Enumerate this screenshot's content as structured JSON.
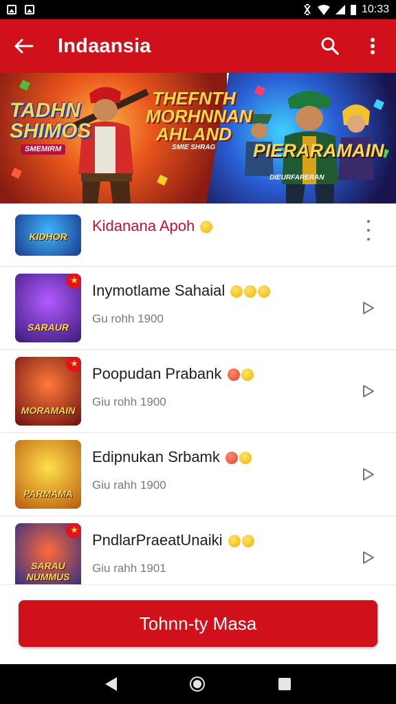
{
  "status_bar": {
    "time": "10:33",
    "icons": [
      "image-notification-icon",
      "photo-notification-icon",
      "vibrate-icon",
      "wifi-icon",
      "signal-icon",
      "battery-icon"
    ]
  },
  "app_bar": {
    "title": "Indaansia",
    "back_icon": "arrow-left-icon",
    "search_icon": "search-icon",
    "menu_icon": "more-vert-icon"
  },
  "banner": {
    "left_text": "TADHN SHIMOS",
    "left_sub": "SMEMIRM",
    "center_text": "THEFNTH MORHNNAN AHLAND",
    "center_sub": "SMIE SHRAG",
    "right_text": "PIERARAMAIN",
    "right_sub": "DIEURFARERAN"
  },
  "list": {
    "items": [
      {
        "title": "Kidanana Apoh",
        "subtitle": "",
        "thumb_caption": "KIDHOR",
        "action": "more-vert-icon",
        "highlight": true
      },
      {
        "title": "Inymotlame Sahaial",
        "subtitle": "Gu rohh 1900",
        "thumb_caption": "SARAUR",
        "action": "play-icon",
        "highlight": false
      },
      {
        "title": "Poopudan Prabank",
        "subtitle": "Giu rohh 1900",
        "thumb_caption": "MORAMAIN",
        "action": "play-icon",
        "highlight": false
      },
      {
        "title": "Edipnukan Srbamk",
        "subtitle": "Giu rahh 1900",
        "thumb_caption": "PARMAMA",
        "action": "play-icon",
        "highlight": false
      },
      {
        "title": "PndlarPraeatUnaiki",
        "subtitle": "Giu rahh 1901",
        "thumb_caption": "SARAU NUMMUS",
        "action": "play-icon",
        "highlight": false
      }
    ]
  },
  "cta": {
    "label": "Tohnn-ty Masa"
  },
  "nav_bar": {
    "back_icon": "nav-back-icon",
    "home_icon": "nav-home-icon",
    "recents_icon": "nav-recents-icon"
  },
  "colors": {
    "brand_red": "#d0101a",
    "title_red": "#c8102e",
    "subtitle_gray": "#7a7a7a"
  }
}
